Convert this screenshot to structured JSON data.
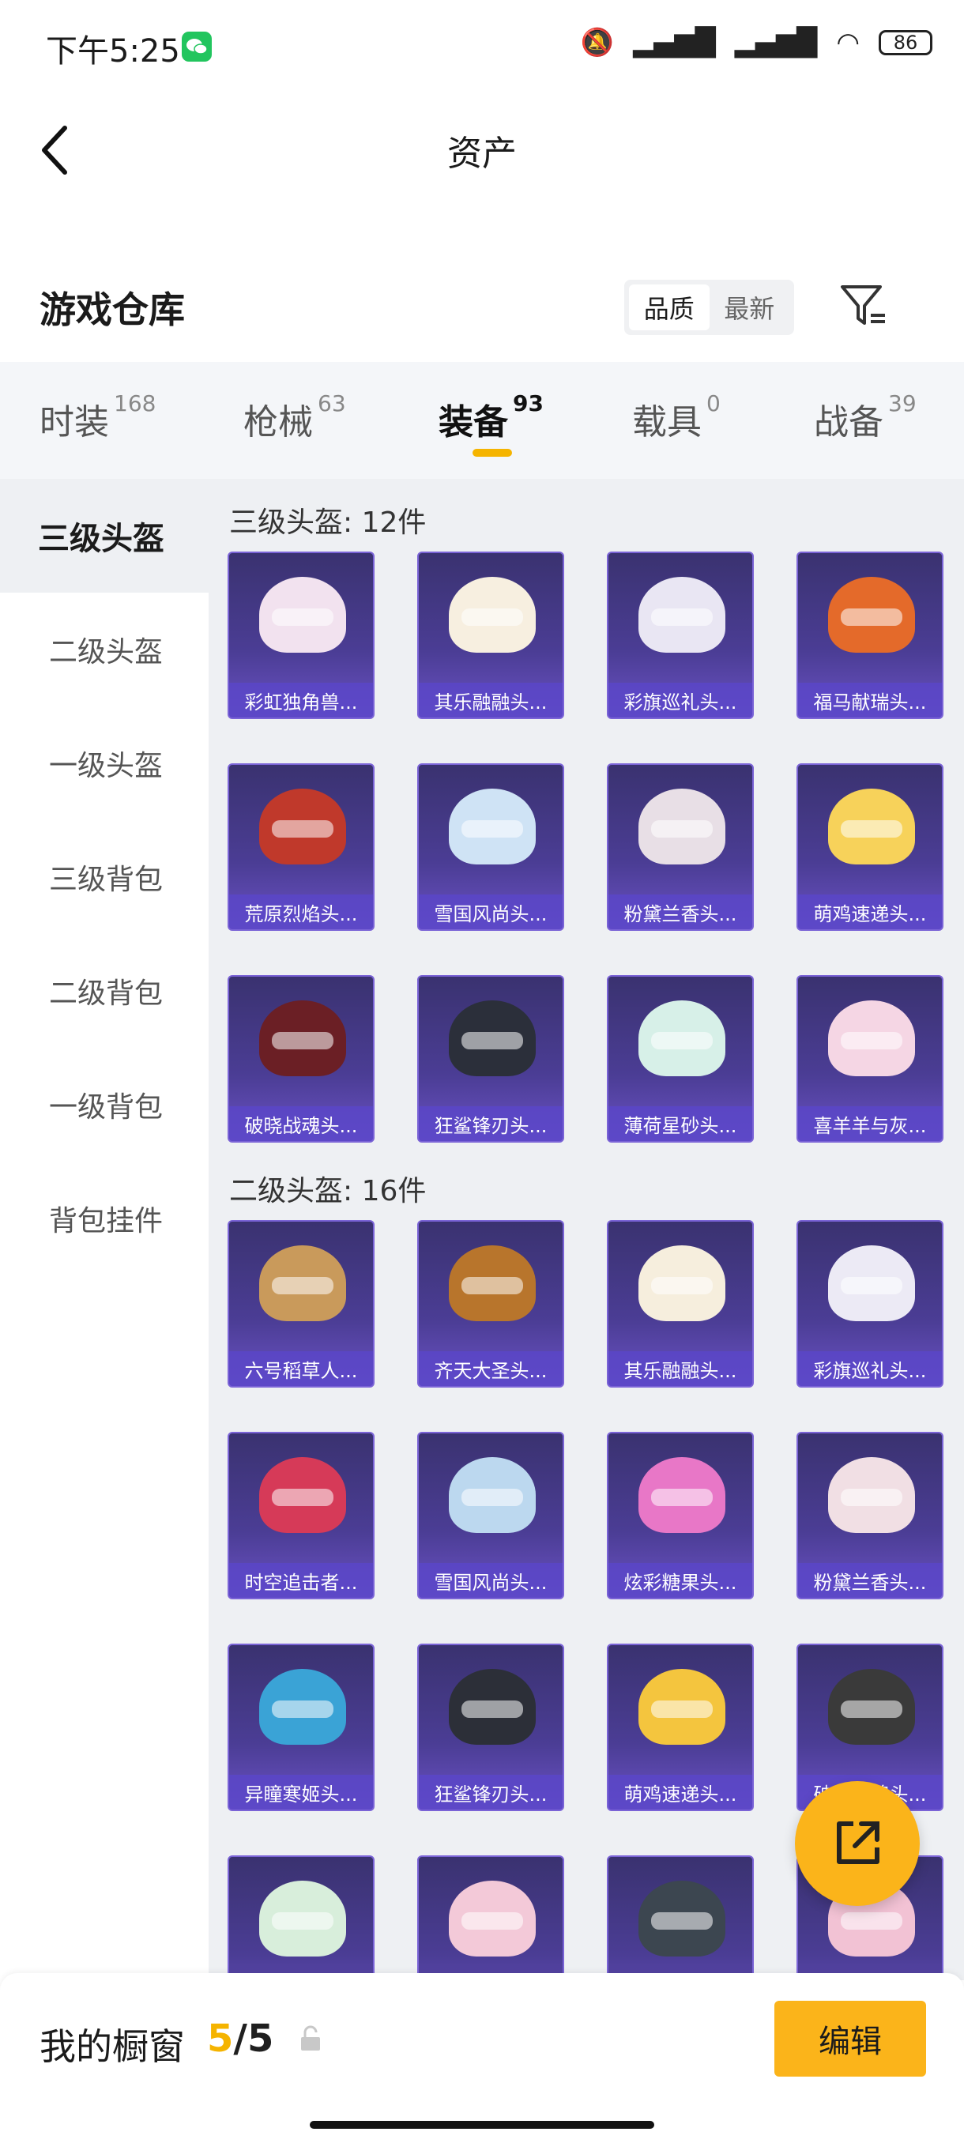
{
  "status_bar": {
    "time": "下午5:25",
    "battery": "86"
  },
  "header": {
    "title": "资产"
  },
  "warehouse": {
    "title": "游戏仓库",
    "sort_quality": "品质",
    "sort_newest": "最新"
  },
  "tabs": [
    {
      "label": "时装",
      "count": "168"
    },
    {
      "label": "枪械",
      "count": "63"
    },
    {
      "label": "装备",
      "count": "93"
    },
    {
      "label": "载具",
      "count": "0"
    },
    {
      "label": "战备",
      "count": "39"
    }
  ],
  "sidebar": {
    "items": [
      "三级头盔",
      "二级头盔",
      "一级头盔",
      "三级背包",
      "二级背包",
      "一级背包",
      "背包挂件"
    ]
  },
  "groups": [
    {
      "label": "三级头盔: 12件",
      "items": [
        "彩虹独角兽...",
        "其乐融融头...",
        "彩旗巡礼头...",
        "福马献瑞头...",
        "荒原烈焰头...",
        "雪国风尚头...",
        "粉黛兰香头...",
        "萌鸡速递头...",
        "破晓战魂头...",
        "狂鲨锋刃头...",
        "薄荷星砂头...",
        "喜羊羊与灰..."
      ],
      "colors": [
        "#f2e2ef",
        "#f7efe0",
        "#e9e6f3",
        "#e46a2a",
        "#c0392b",
        "#cfe3f5",
        "#e8dfe6",
        "#f7d25a",
        "#6b1f25",
        "#2b2f3a",
        "#d7f0e8",
        "#f5d6e4"
      ]
    },
    {
      "label": "二级头盔: 16件",
      "items": [
        "六号稻草人...",
        "齐天大圣头...",
        "其乐融融头...",
        "彩旗巡礼头...",
        "时空追击者...",
        "雪国风尚头...",
        "炫彩糖果头...",
        "粉黛兰香头...",
        "异瞳寒姬头...",
        "狂鲨锋刃头...",
        "萌鸡速递头...",
        "破晓战魂头...",
        "",
        "",
        "",
        ""
      ],
      "colors": [
        "#c99a5b",
        "#b8752c",
        "#f6eedd",
        "#eceaf5",
        "#d63a58",
        "#bcd8ef",
        "#e877c7",
        "#f1dfe4",
        "#3aa3d6",
        "#2c2f38",
        "#f4c53e",
        "#3a3a3a",
        "#d8eedb",
        "#f3c9d8",
        "#3c4650",
        "#f2c2d4"
      ]
    }
  ],
  "bottom_bar": {
    "label": "我的橱窗",
    "current": "5",
    "total": "/5",
    "edit": "编辑"
  }
}
